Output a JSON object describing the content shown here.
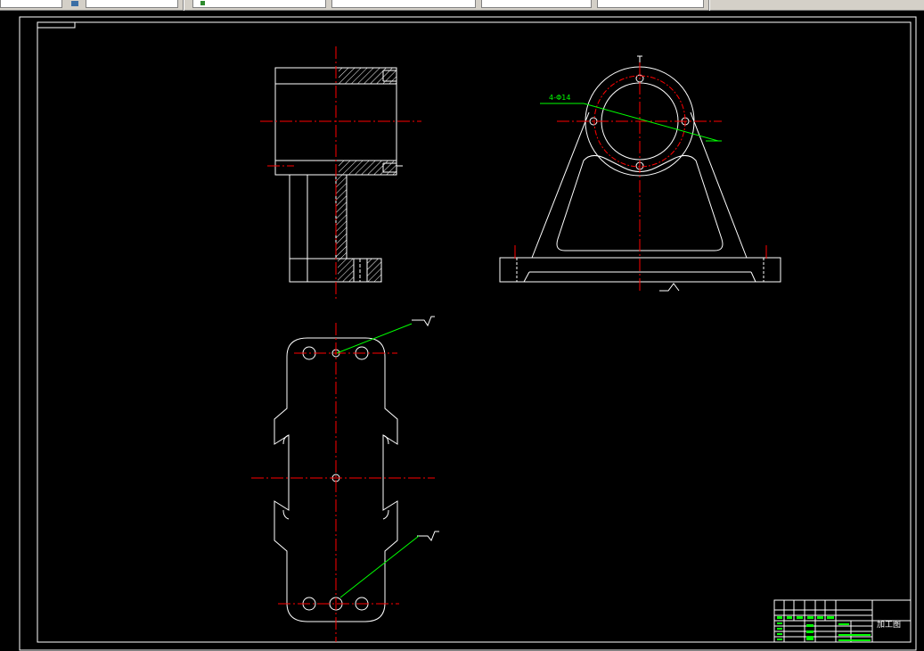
{
  "toolbar": {
    "fields": [
      "",
      "",
      "",
      "",
      "",
      ""
    ]
  },
  "drawing": {
    "colors": {
      "background": "#000000",
      "outline": "#ffffff",
      "centerline": "#ff0000",
      "leader": "#00ff00",
      "pitch_circle": "#ff0000"
    },
    "annotations": {
      "circle_leader_label": "4-Φ14",
      "title_block_name": "加工图"
    }
  }
}
